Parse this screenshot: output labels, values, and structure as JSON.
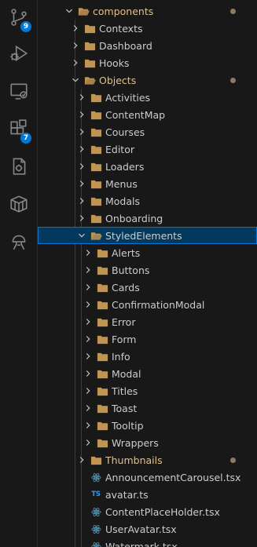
{
  "colors": {
    "folder": "#c09553",
    "modified_text": "#e2c08d",
    "text": "#cccccc",
    "selection": "#04395e",
    "selection_border": "#0078d4",
    "react_icon": "#519aba",
    "ts_icon": "#3b95e8",
    "badge": "#0078d4"
  },
  "activity_bar": [
    {
      "name": "source-control",
      "icon": "source-control-icon",
      "badge": "9"
    },
    {
      "name": "run-debug",
      "icon": "debug-icon",
      "badge": ""
    },
    {
      "name": "remote-explorer",
      "icon": "remote-explorer-icon",
      "badge": ""
    },
    {
      "name": "extensions",
      "icon": "extensions-icon",
      "badge": "7"
    },
    {
      "name": "testing",
      "icon": "testing-icon",
      "badge": ""
    },
    {
      "name": "containers",
      "icon": "container-icon",
      "badge": ""
    },
    {
      "name": "accounts",
      "icon": "person-icon",
      "badge": ""
    }
  ],
  "tree": [
    {
      "label": "components",
      "type": "folder",
      "expanded": true,
      "modified": true,
      "icon": "folder-special-icon"
    },
    {
      "label": "Contexts",
      "type": "folder",
      "expanded": false,
      "modified": false
    },
    {
      "label": "Dashboard",
      "type": "folder",
      "expanded": false,
      "modified": false
    },
    {
      "label": "Hooks",
      "type": "folder",
      "expanded": false,
      "modified": false
    },
    {
      "label": "Objects",
      "type": "folder",
      "expanded": true,
      "modified": true
    },
    {
      "label": "Activities",
      "type": "folder",
      "expanded": false,
      "modified": false
    },
    {
      "label": "ContentMap",
      "type": "folder",
      "expanded": false,
      "modified": false
    },
    {
      "label": "Courses",
      "type": "folder",
      "expanded": false,
      "modified": false
    },
    {
      "label": "Editor",
      "type": "folder",
      "expanded": false,
      "modified": false
    },
    {
      "label": "Loaders",
      "type": "folder",
      "expanded": false,
      "modified": false
    },
    {
      "label": "Menus",
      "type": "folder",
      "expanded": false,
      "modified": false
    },
    {
      "label": "Modals",
      "type": "folder",
      "expanded": false,
      "modified": false
    },
    {
      "label": "Onboarding",
      "type": "folder",
      "expanded": false,
      "modified": false
    },
    {
      "label": "StyledElements",
      "type": "folder",
      "expanded": true,
      "modified": false,
      "selected": true
    },
    {
      "label": "Alerts",
      "type": "folder",
      "expanded": false,
      "modified": false
    },
    {
      "label": "Buttons",
      "type": "folder",
      "expanded": false,
      "modified": false
    },
    {
      "label": "Cards",
      "type": "folder",
      "expanded": false,
      "modified": false
    },
    {
      "label": "ConfirmationModal",
      "type": "folder",
      "expanded": false,
      "modified": false
    },
    {
      "label": "Error",
      "type": "folder",
      "expanded": false,
      "modified": false
    },
    {
      "label": "Form",
      "type": "folder",
      "expanded": false,
      "modified": false
    },
    {
      "label": "Info",
      "type": "folder",
      "expanded": false,
      "modified": false
    },
    {
      "label": "Modal",
      "type": "folder",
      "expanded": false,
      "modified": false
    },
    {
      "label": "Titles",
      "type": "folder",
      "expanded": false,
      "modified": false
    },
    {
      "label": "Toast",
      "type": "folder",
      "expanded": false,
      "modified": false
    },
    {
      "label": "Tooltip",
      "type": "folder",
      "expanded": false,
      "modified": false
    },
    {
      "label": "Wrappers",
      "type": "folder",
      "expanded": false,
      "modified": false
    },
    {
      "label": "Thumbnails",
      "type": "folder",
      "expanded": false,
      "modified": true
    },
    {
      "label": "AnnouncementCarousel.tsx",
      "type": "tsx",
      "icon": "react-icon"
    },
    {
      "label": "avatar.ts",
      "type": "ts",
      "icon": "typescript-icon",
      "icon_text": "TS"
    },
    {
      "label": "ContentPlaceHolder.tsx",
      "type": "tsx",
      "icon": "react-icon"
    },
    {
      "label": "UserAvatar.tsx",
      "type": "tsx",
      "icon": "react-icon"
    },
    {
      "label": "Watermark.tsx",
      "type": "tsx",
      "icon": "react-icon"
    }
  ]
}
